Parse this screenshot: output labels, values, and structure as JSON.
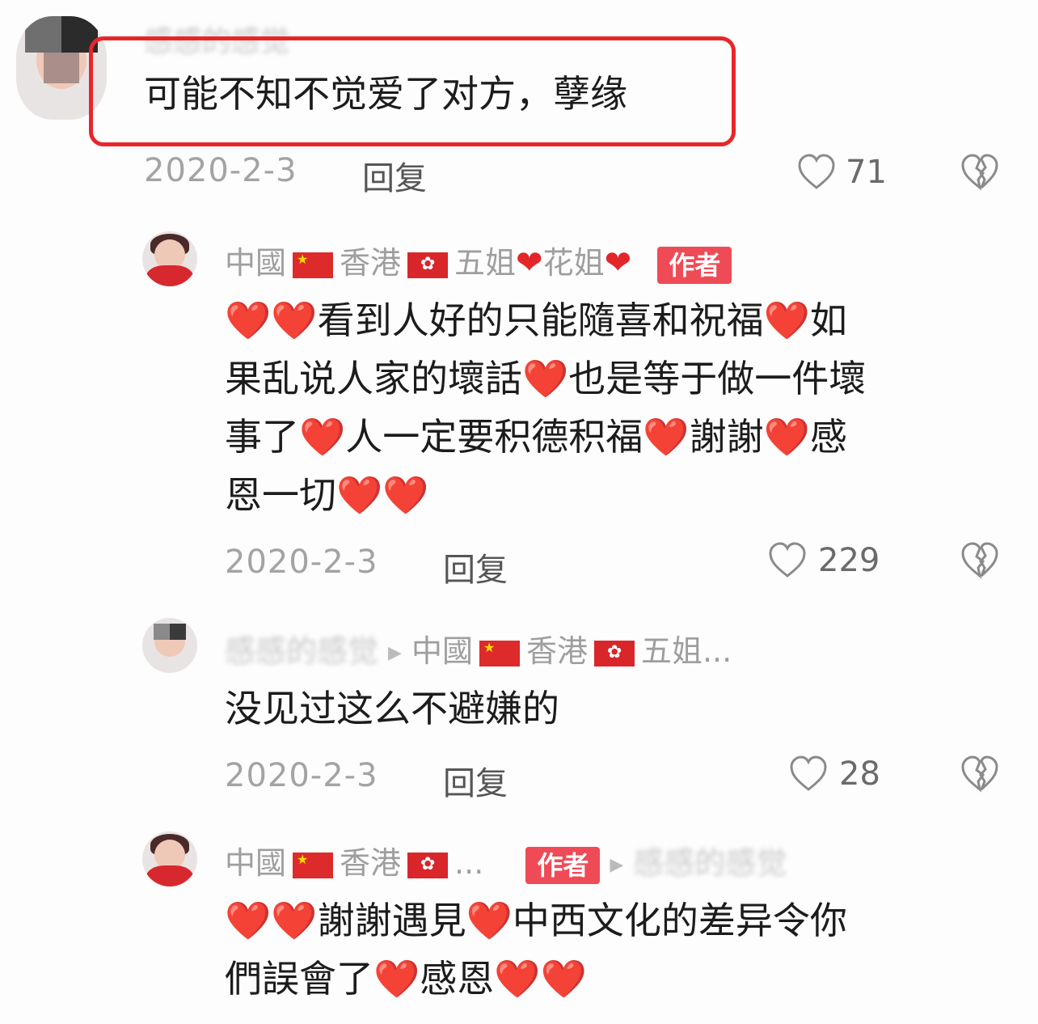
{
  "colors": {
    "heart": "#e3262a",
    "highlight": "#e8262a",
    "author_badge": "#ef4b57",
    "muted": "#a3a3a3"
  },
  "comments": [
    {
      "username": "感感的感觉",
      "text": "可能不知不觉爱了对方，孽缘",
      "date": "2020-2-3",
      "reply_label": "回复",
      "likes": "71"
    },
    {
      "username_parts": [
        "中國",
        "香港",
        "五姐",
        "花姐"
      ],
      "badge": "作者",
      "text_lines": [
        [
          "❤️❤️",
          "看到人好的只能隨喜和祝福",
          "❤️",
          "如"
        ],
        [
          "果乱说人家的壞話",
          "❤️",
          "也是等于做一件壞"
        ],
        [
          "事了",
          "❤️",
          "人一定要积德积福",
          "❤️",
          "謝謝",
          "❤️",
          "感"
        ],
        [
          "恩一切",
          "❤️❤️"
        ]
      ],
      "date": "2020-2-3",
      "reply_label": "回复",
      "likes": "229"
    },
    {
      "username": "感感的感觉",
      "reply_to_parts": [
        "中國",
        "香港",
        "五姐..."
      ],
      "text": "没见过这么不避嫌的",
      "date": "2020-2-3",
      "reply_label": "回复",
      "likes": "28"
    },
    {
      "username_parts": [
        "中國",
        "香港",
        "..."
      ],
      "badge": "作者",
      "reply_to": "感感的感觉",
      "text_lines": [
        [
          "❤️❤️",
          "謝謝遇見",
          "❤️",
          "中西文化的差异令你"
        ],
        [
          "們誤會了",
          "❤️",
          "感恩",
          "❤️❤️"
        ]
      ]
    }
  ],
  "icons": {
    "like": "heart-outline-icon",
    "dislike": "broken-heart-icon",
    "flag_cn": "china-flag-icon",
    "flag_hk": "hongkong-flag-icon",
    "arrow": "triangle-right-icon"
  }
}
